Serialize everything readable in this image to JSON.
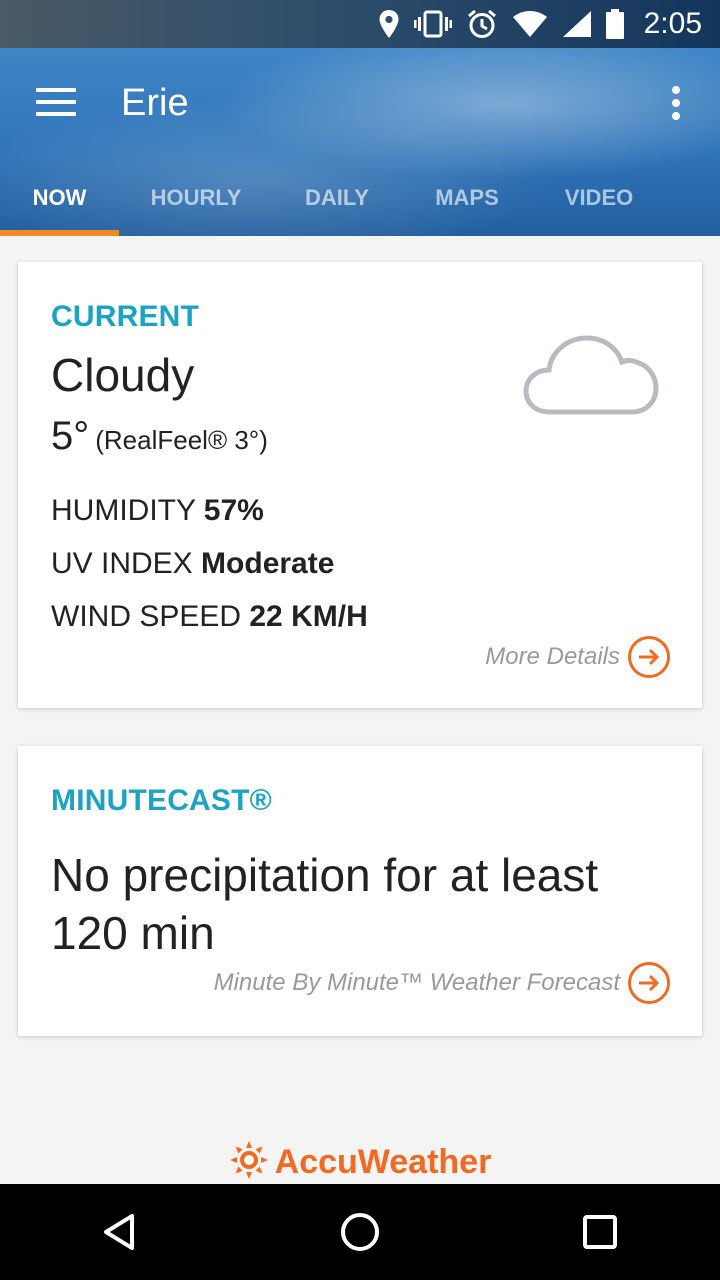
{
  "status_bar": {
    "time": "2:05",
    "icons": [
      "location-icon",
      "vibrate-icon",
      "alarm-icon",
      "wifi-icon",
      "signal-icon",
      "battery-icon"
    ]
  },
  "header": {
    "city": "Erie",
    "tabs": [
      {
        "label": "NOW",
        "active": true
      },
      {
        "label": "HOURLY",
        "active": false
      },
      {
        "label": "DAILY",
        "active": false
      },
      {
        "label": "MAPS",
        "active": false
      },
      {
        "label": "VIDEO",
        "active": false
      }
    ]
  },
  "current": {
    "section_label": "CURRENT",
    "condition": "Cloudy",
    "condition_icon": "cloud-icon",
    "temperature": "5°",
    "realfeel": "(RealFeel® 3°)",
    "humidity_label": "HUMIDITY",
    "humidity_value": "57%",
    "uv_label": "UV INDEX",
    "uv_value": "Moderate",
    "wind_label": "WIND SPEED",
    "wind_value": "22 KM/H",
    "more_details": "More Details"
  },
  "minutecast": {
    "section_label": "MINUTECAST®",
    "summary": "No precipitation for at least 120 min",
    "link": "Minute By Minute™ Weather Forecast"
  },
  "footer": {
    "brand": "AccuWeather"
  },
  "colors": {
    "accent_orange": "#f26a22",
    "section_teal": "#1aa3c2",
    "tab_indicator": "#f08a24"
  }
}
